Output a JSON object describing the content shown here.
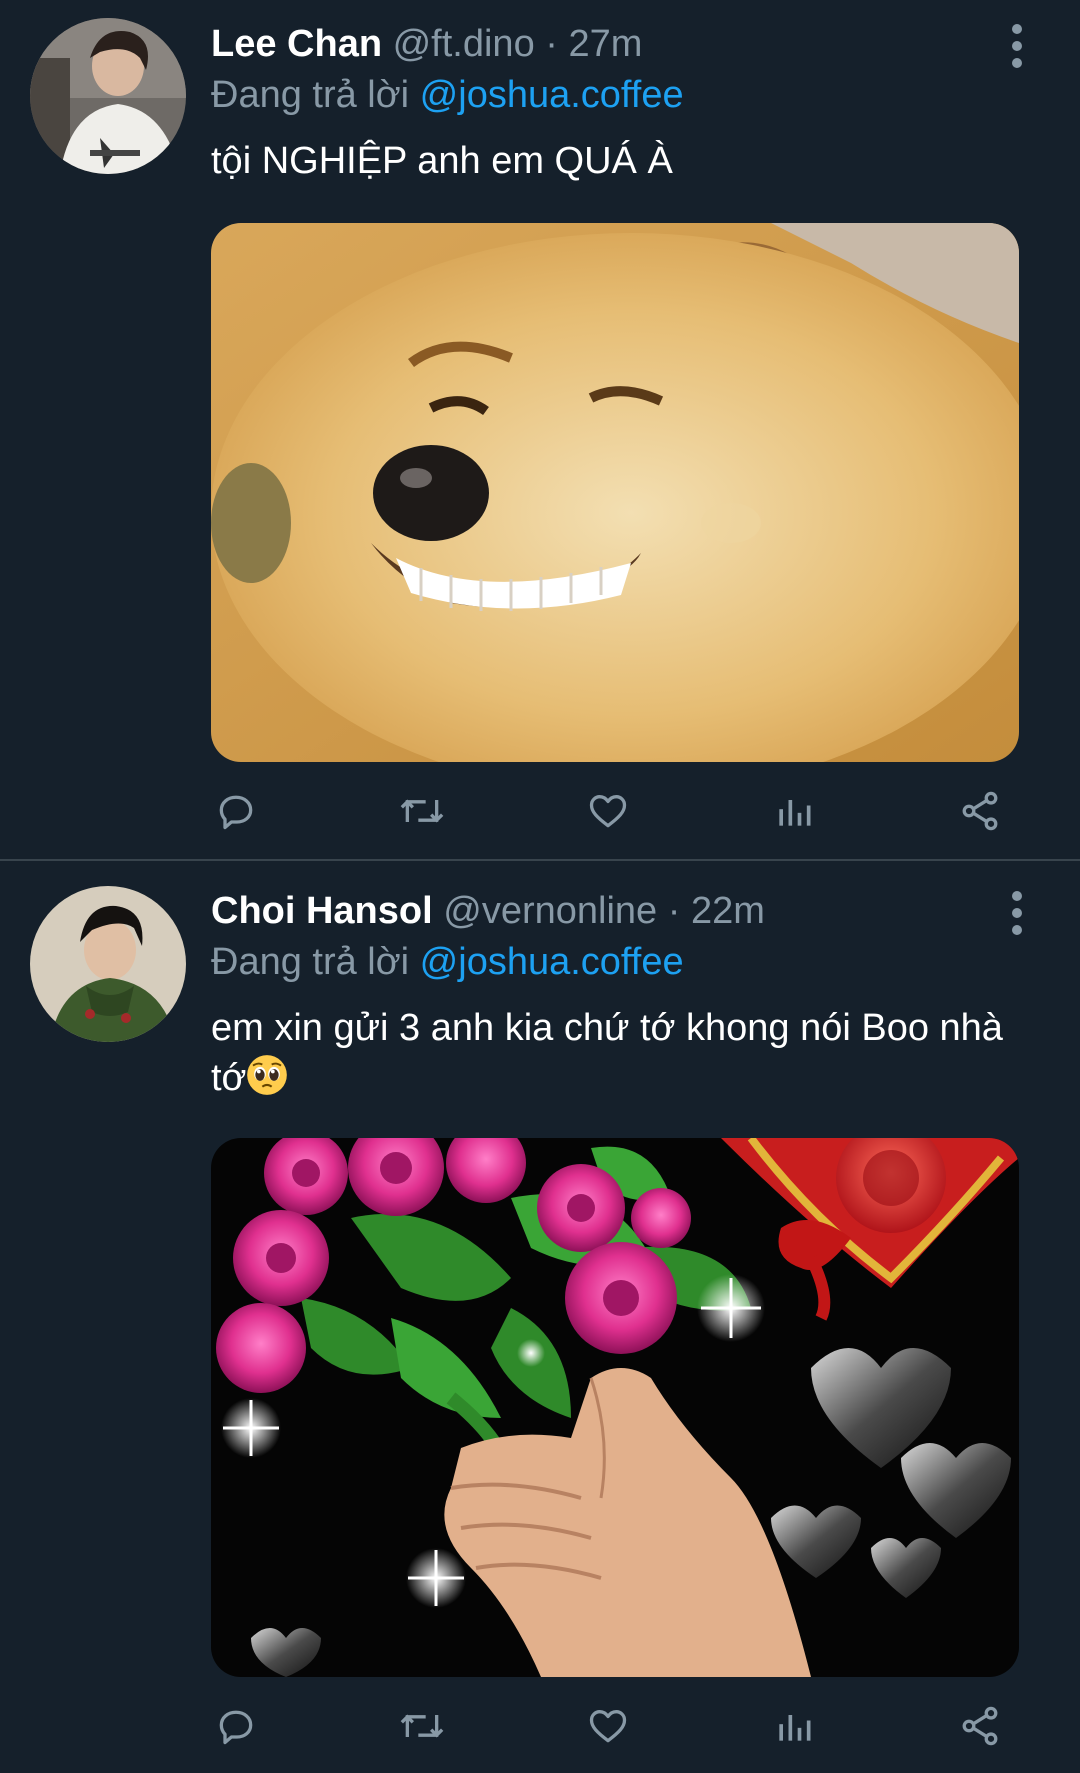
{
  "tweets": [
    {
      "name": "Lee Chan",
      "handle": "@ft.dino",
      "separator": "·",
      "time": "27m",
      "reply_prefix": "Đang trả lời",
      "reply_to": "@joshua.coffee",
      "text": "tội NGHIỆP anh em QUÁ À",
      "media_subject": "shiba-inu-grinning-meme"
    },
    {
      "name": "Choi Hansol",
      "handle": "@vernonline",
      "separator": "·",
      "time": "22m",
      "reply_prefix": "Đang trả lời",
      "reply_to": "@joshua.coffee",
      "text": "em xin gửi 3 anh kia chứ tớ khong nói Boo nhà tớ",
      "text_emoji": "pleading-face-emoji",
      "media_subject": "hand-holding-pink-roses-with-hearts"
    }
  ],
  "actions": [
    "reply-icon",
    "retweet-icon",
    "like-icon",
    "analytics-icon",
    "share-icon"
  ],
  "colors": {
    "background": "#15202b",
    "secondary_text": "#8899a6",
    "link": "#1da1f2",
    "divider": "#38444d"
  }
}
